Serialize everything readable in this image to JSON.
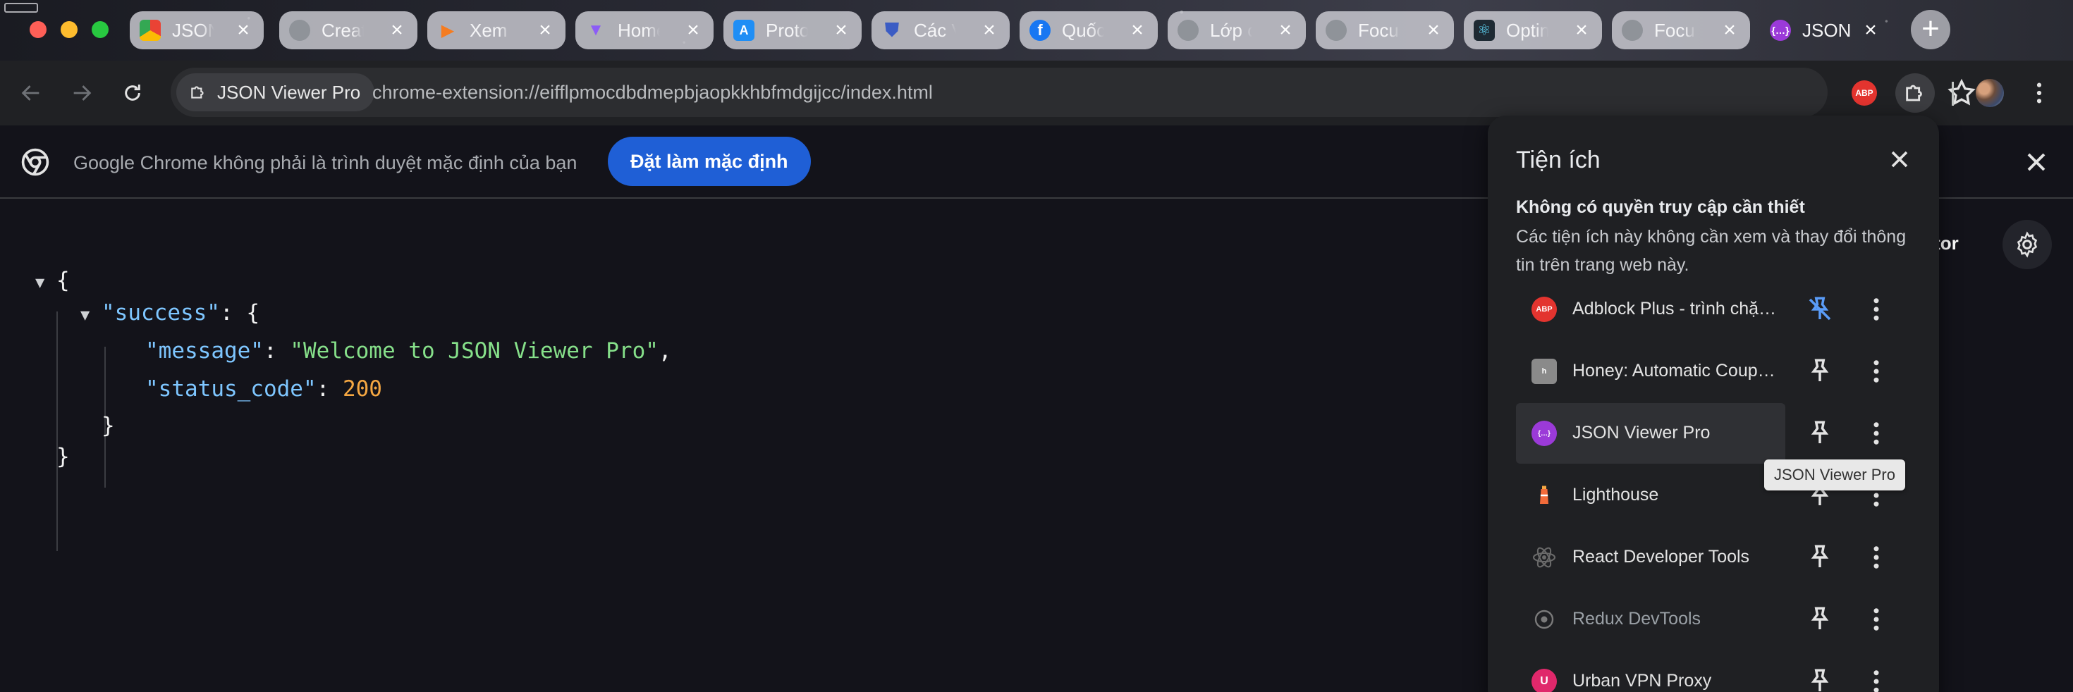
{
  "tabs": [
    {
      "title": "JSON",
      "icon": "chrome-web-store-icon",
      "color": "#e8e8e8"
    },
    {
      "title": "Create",
      "icon": "globe-icon",
      "color": "#9aa0a6"
    },
    {
      "title": "Xem T",
      "icon": "play-icon",
      "color": "#f57c20"
    },
    {
      "title": "Home",
      "icon": "vite-icon",
      "color": "#8c5cf6"
    },
    {
      "title": "Proton",
      "icon": "app-store-icon",
      "color": "#1f8ef5"
    },
    {
      "title": "Các V",
      "icon": "shield-icon",
      "color": "#3b5cc4"
    },
    {
      "title": "Quốc",
      "icon": "facebook-icon",
      "color": "#1877f2"
    },
    {
      "title": "Lớp c",
      "icon": "globe-icon",
      "color": "#9aa0a6"
    },
    {
      "title": "Focus",
      "icon": "globe-icon",
      "color": "#9aa0a6"
    },
    {
      "title": "Optin",
      "icon": "react-icon",
      "color": "#61dafb"
    },
    {
      "title": "Focus",
      "icon": "globe-icon",
      "color": "#9aa0a6"
    },
    {
      "title": "JSON",
      "icon": "json-viewer-icon",
      "color": "#9b3ad8",
      "active": true
    }
  ],
  "toolbar": {
    "site_chip": "JSON Viewer Pro",
    "url": "chrome-extension://eifflpmocdbdmepbjaopkkhbfmdgijcc/index.html",
    "abp_badge": "ABP"
  },
  "infobar": {
    "message": "Google Chrome không phải là trình duyệt mặc định của bạn",
    "button": "Đặt làm mặc định"
  },
  "json_view": {
    "open_brace": "{",
    "close_brace": "}",
    "success_key": "\"success\"",
    "colon": ": ",
    "message_key": "\"message\"",
    "message_value": "\"Welcome to JSON Viewer Pro\"",
    "status_key": "\"status_code\"",
    "status_value": "200",
    "comma": ",",
    "editor_label": "ditor"
  },
  "popup": {
    "title": "Tiện ích",
    "heading": "Không có quyền truy cập cần thiết",
    "description": "Các tiện ích này không cần xem và thay đổi thông tin trên trang web này.",
    "extensions": [
      {
        "name": "Adblock Plus - trình chặn quảng cáo",
        "icon": "adblock-plus-icon",
        "icon_text": "ABP",
        "color": "#e3342f",
        "pinned": true
      },
      {
        "name": "Honey: Automatic Coupons & Rewards",
        "icon": "honey-icon",
        "icon_text": "h",
        "color": "#8a8a8a"
      },
      {
        "name": "JSON Viewer Pro",
        "icon": "json-viewer-icon",
        "icon_text": "{…}",
        "color": "#9b3ad8",
        "hover": true
      },
      {
        "name": "Lighthouse",
        "icon": "lighthouse-icon",
        "icon_text": "",
        "color": "#f26b3a"
      },
      {
        "name": "React Developer Tools",
        "icon": "react-icon",
        "icon_text": "",
        "color": "#5a5a5a"
      },
      {
        "name": "Redux DevTools",
        "icon": "redux-icon",
        "icon_text": "",
        "color": "#4a4a4a",
        "dim": true
      },
      {
        "name": "Urban VPN Proxy",
        "icon": "urban-vpn-icon",
        "icon_text": "U",
        "color": "#e0286b"
      }
    ],
    "tooltip": "JSON Viewer Pro"
  }
}
